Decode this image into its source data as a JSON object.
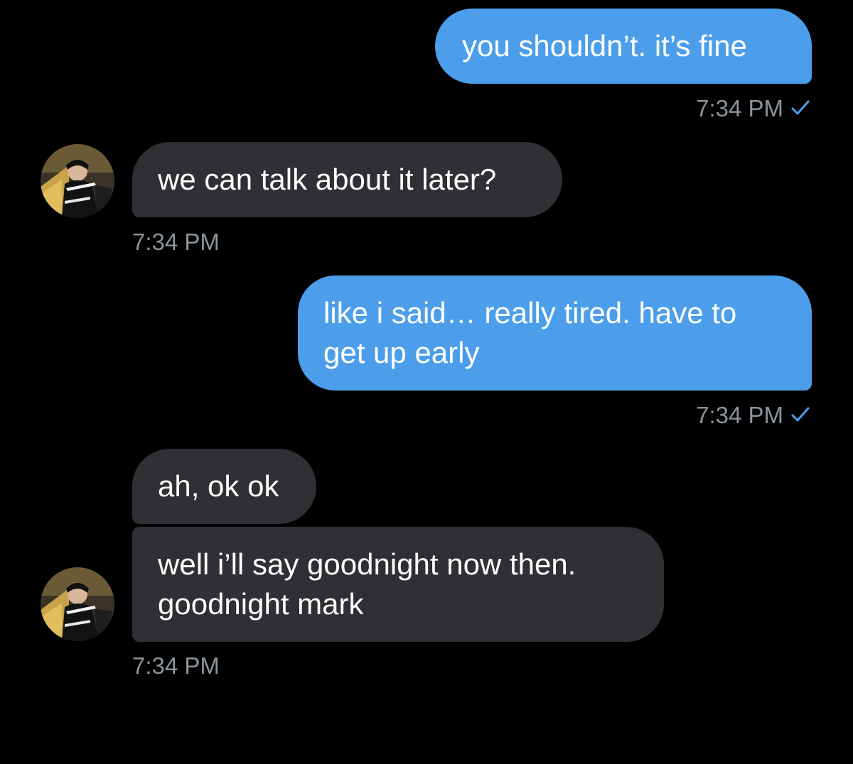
{
  "accent_color": "#4c9eeb",
  "incoming_bubble_color": "#2e3034",
  "timestamp_color": "#8b939b",
  "messages": [
    {
      "direction": "outgoing",
      "text": "you shouldn’t. it’s fine",
      "time": "7:34 PM",
      "read_icon": "check-icon"
    },
    {
      "direction": "incoming",
      "text": "we can talk about it later?",
      "time": "7:34 PM",
      "avatar_icon": "user-avatar"
    },
    {
      "direction": "outgoing",
      "text": "like i said… really tired. have to\nget up early",
      "time": "7:34 PM",
      "read_icon": "check-icon"
    },
    {
      "direction": "incoming",
      "text": "ah, ok ok"
    },
    {
      "direction": "incoming",
      "text": "well i’ll say goodnight now then.\ngoodnight mark",
      "time": "7:34 PM",
      "avatar_icon": "user-avatar"
    }
  ]
}
